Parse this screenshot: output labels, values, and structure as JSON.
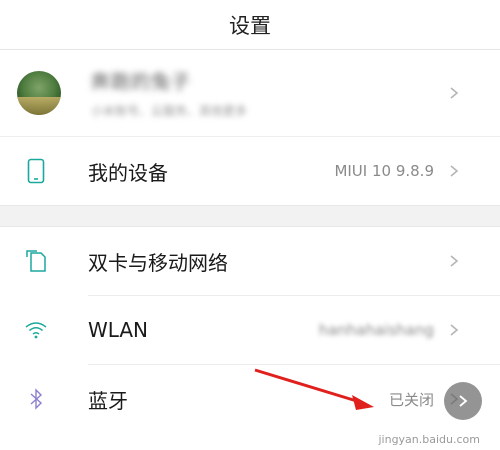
{
  "header": {
    "title": "设置"
  },
  "account": {
    "name": "奔跑的兔子",
    "subtitle": "小米账号、云服务、其他更多"
  },
  "rows": {
    "device": {
      "label": "我的设备",
      "value": "MIUI 10 9.8.9"
    },
    "sim": {
      "label": "双卡与移动网络",
      "value": ""
    },
    "wlan": {
      "label": "WLAN",
      "value": "hanhahaishang"
    },
    "bluetooth": {
      "label": "蓝牙",
      "value": "已关闭"
    }
  },
  "watermark": "jingyan.baidu.com",
  "colors": {
    "accent_teal": "#1ba99d",
    "bluetooth_purple": "#8a7fd0",
    "arrow_red": "#e0201d",
    "chevron": "#b5b5b5"
  },
  "icons": {
    "device": "phone-icon",
    "sim": "sim-cards-icon",
    "wlan": "wifi-icon",
    "bluetooth": "bluetooth-icon",
    "chevron": "chevron-right-icon"
  }
}
